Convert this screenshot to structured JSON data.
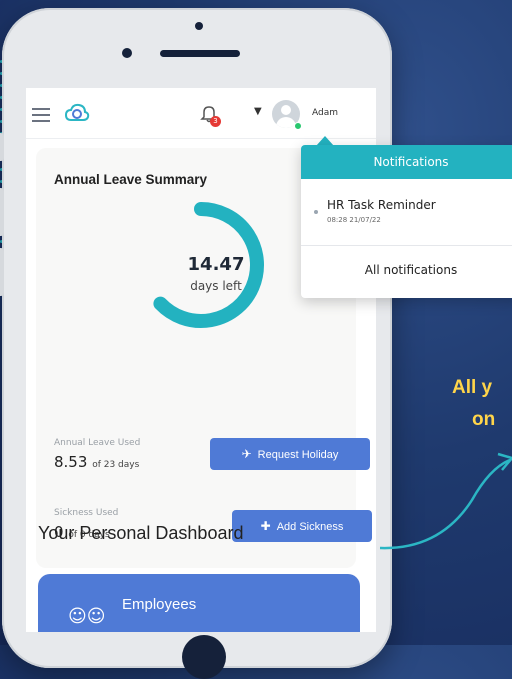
{
  "header": {
    "username": "Adam",
    "notification_count": "3"
  },
  "summary": {
    "title": "Annual Leave Summary",
    "days_value": "14.47",
    "days_label": "days left",
    "leave_used_label": "Annual Leave Used",
    "leave_used_value": "8.53",
    "leave_used_total": "of 23 days",
    "sickness_label": "Sickness Used",
    "sickness_value": "0",
    "sickness_total": "of 0 days",
    "request_holiday": "Request Holiday",
    "add_sickness": "Add Sickness",
    "remaining_fraction": 0.629
  },
  "dashboard": {
    "title": "Your Personal Dashboard",
    "employees_title": "Employees"
  },
  "notifications": {
    "header": "Notifications",
    "items": [
      {
        "title": "HR Task Reminder",
        "time": "08:28 21/07/22"
      }
    ],
    "all_link": "All notifications"
  },
  "promo": {
    "line1": "All y",
    "line2": "on"
  },
  "colors": {
    "accent": "#23b2c0",
    "button": "#4f7ad6",
    "promo": "#ffd54a",
    "background": "#1f3a6e"
  }
}
